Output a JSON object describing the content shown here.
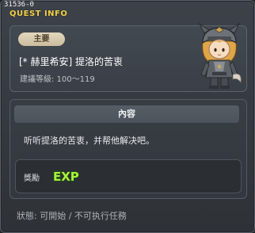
{
  "window": {
    "quest_id": "31536-0",
    "title": "QUEST INFO"
  },
  "quest": {
    "category": "主要",
    "title": "[* 赫里希安] 提洛的苦衷",
    "level_range": "建議等級: 100～119",
    "npc_icon": "npc-portrait"
  },
  "content": {
    "header": "內容",
    "description": "听听提洛的苦衷，并帮他解决吧。"
  },
  "reward": {
    "label": "獎勵",
    "exp_text": "EXP",
    "exp_icon": "exp-icon"
  },
  "status": {
    "text": "狀態: 可開始 / 不可执行任務"
  },
  "colors": {
    "title_accent": "#f3d34a",
    "badge_bg": "#d8cbb0",
    "exp_green": "#9ef03a"
  }
}
